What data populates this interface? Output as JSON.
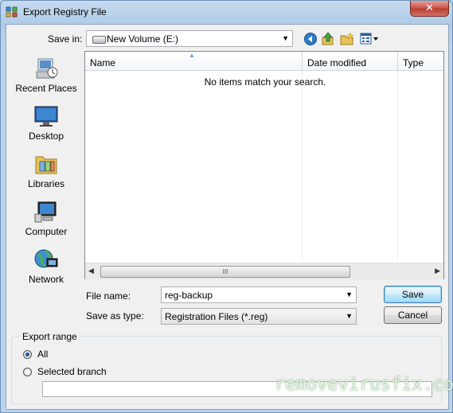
{
  "window": {
    "title": "Export Registry File",
    "close_label": "✕"
  },
  "toolbar": {
    "save_in_label": "Save in:",
    "save_in_value": "New Volume (E:)",
    "back_icon": "back-arrow-icon",
    "up_icon": "up-folder-icon",
    "new_folder_icon": "new-folder-icon",
    "views_icon": "views-menu-icon"
  },
  "places": [
    {
      "label": "Recent Places",
      "icon": "recent-places-icon"
    },
    {
      "label": "Desktop",
      "icon": "desktop-icon"
    },
    {
      "label": "Libraries",
      "icon": "libraries-icon"
    },
    {
      "label": "Computer",
      "icon": "computer-icon"
    },
    {
      "label": "Network",
      "icon": "network-icon"
    }
  ],
  "filelist": {
    "columns": [
      "Name",
      "Date modified",
      "Type"
    ],
    "empty_message": "No items match your search.",
    "scroll_grip": "III"
  },
  "form": {
    "file_name_label": "File name:",
    "file_name_value": "reg-backup",
    "save_type_label": "Save as type:",
    "save_type_value": "Registration Files (*.reg)",
    "save_button": "Save",
    "cancel_button": "Cancel"
  },
  "export_range": {
    "title": "Export range",
    "option_all": "All",
    "option_branch": "Selected branch",
    "selected": "All",
    "branch_value": ""
  },
  "watermark": "removevirusfix.com",
  "colors": {
    "accent": "#3c7fb1",
    "close": "#c75050"
  }
}
